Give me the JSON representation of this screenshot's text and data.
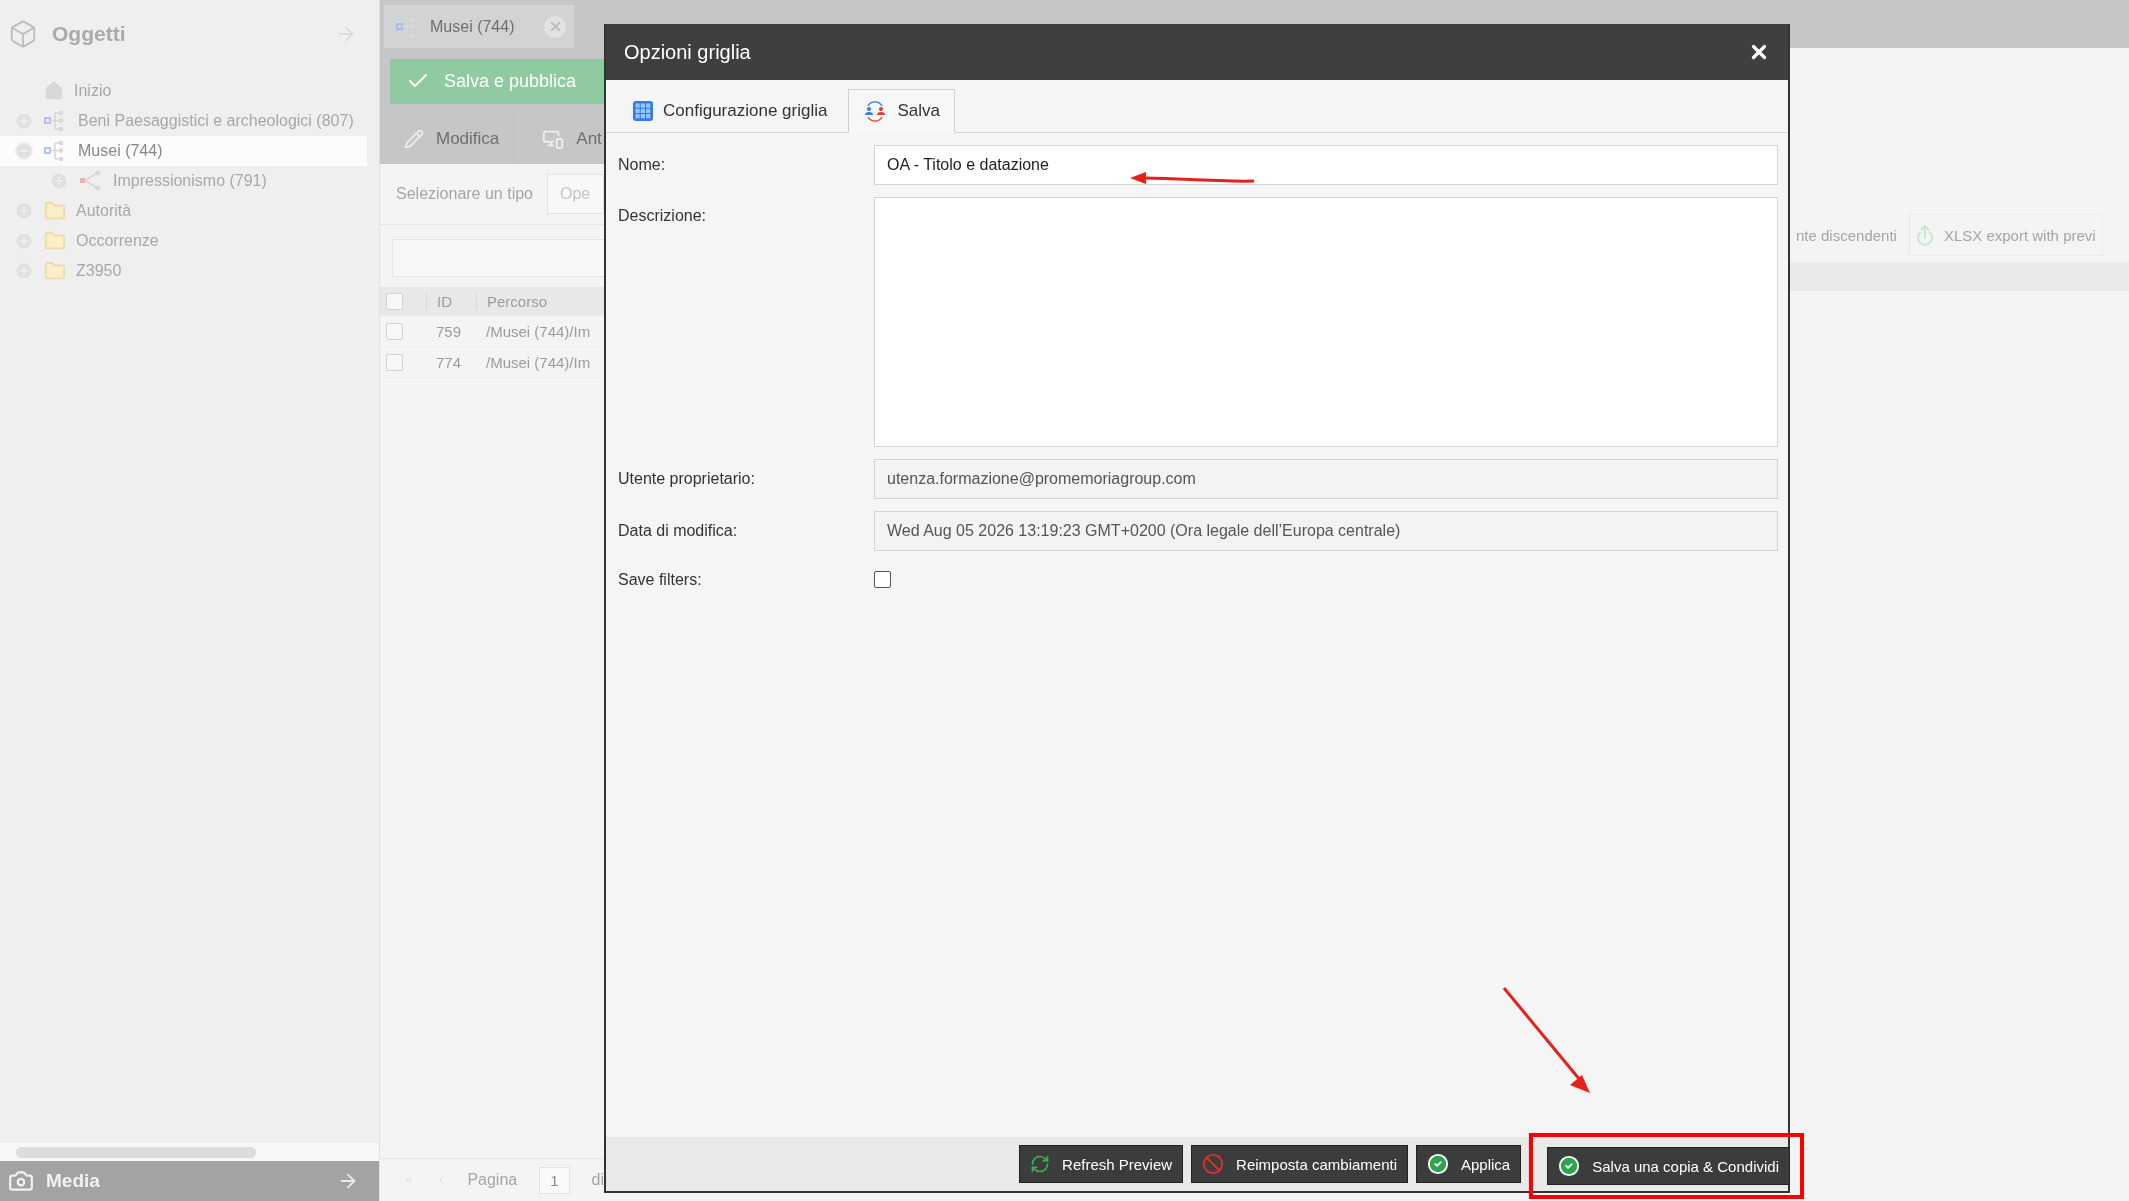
{
  "sidebar": {
    "title": "Oggetti",
    "tree": [
      {
        "kind": "home",
        "label": "Inizio",
        "selected": false
      },
      {
        "kind": "tree",
        "label": "Beni Paesaggistici e archeologici (807)",
        "expanded": false,
        "selected": false
      },
      {
        "kind": "tree",
        "label": "Musei (744)",
        "expanded": true,
        "selected": true,
        "children": [
          {
            "kind": "branch",
            "label": "Impressionismo (791)",
            "expanded": false,
            "selected": false
          }
        ]
      },
      {
        "kind": "folder",
        "label": "Autorità",
        "expanded": false,
        "selected": false
      },
      {
        "kind": "folder",
        "label": "Occorrenze",
        "expanded": false,
        "selected": false
      },
      {
        "kind": "folder",
        "label": "Z3950",
        "expanded": false,
        "selected": false
      }
    ],
    "bottom_panel": {
      "title": "Media"
    }
  },
  "main": {
    "tab": {
      "label": "Musei (744)"
    },
    "publish_button": "Salva e pubblica",
    "toolbar": [
      {
        "kind": "edit",
        "label": "Modifica"
      },
      {
        "kind": "preview",
        "label": "Ant"
      }
    ],
    "type_selector": {
      "label": "Selezionare un tipo",
      "value": "Ope"
    },
    "grid": {
      "columns": [
        "ID",
        "Percorso"
      ],
      "header_checked": false,
      "rows": [
        {
          "id": "759",
          "path": "/Musei (744)/Im",
          "checked": false
        },
        {
          "id": "774",
          "path": "/Musei (744)/Im",
          "checked": false
        }
      ]
    },
    "right_toolbar": [
      {
        "kind": "text",
        "label": "nte discendenti"
      },
      {
        "kind": "export",
        "label": "XLSX export with previ"
      }
    ],
    "pager": {
      "label": "Pagina",
      "value": "1",
      "of": "di"
    }
  },
  "dialog": {
    "title": "Opzioni griglia",
    "tabs": [
      {
        "kind": "grid",
        "label": "Configurazione griglia",
        "selected": false
      },
      {
        "kind": "share",
        "label": "Salva",
        "selected": true
      }
    ],
    "fields": [
      {
        "kind": "text",
        "label": "Nome:",
        "value": "OA - Titolo e datazione",
        "readonly": false
      },
      {
        "kind": "textarea",
        "label": "Descrizione:"
      },
      {
        "kind": "text",
        "label": "Utente proprietario:",
        "value": "utenza.formazione@promemoriagroup.com",
        "readonly": true
      },
      {
        "kind": "text",
        "label": "Data di modifica:",
        "value": "Wed Aug 05 2026 13:19:23 GMT+0200 (Ora legale dell’Europa centrale)",
        "readonly": true
      },
      {
        "kind": "checkbox",
        "label": "Save filters:",
        "checked": false
      }
    ],
    "buttons": [
      {
        "kind": "refresh",
        "label": "Refresh Preview",
        "highlighted": false
      },
      {
        "kind": "reset",
        "label": "Reimposta cambiamenti",
        "highlighted": false
      },
      {
        "kind": "apply",
        "label": "Applica",
        "highlighted": false
      },
      {
        "kind": "apply",
        "label": "Salva una copia & Condividi",
        "highlighted": true
      }
    ]
  }
}
